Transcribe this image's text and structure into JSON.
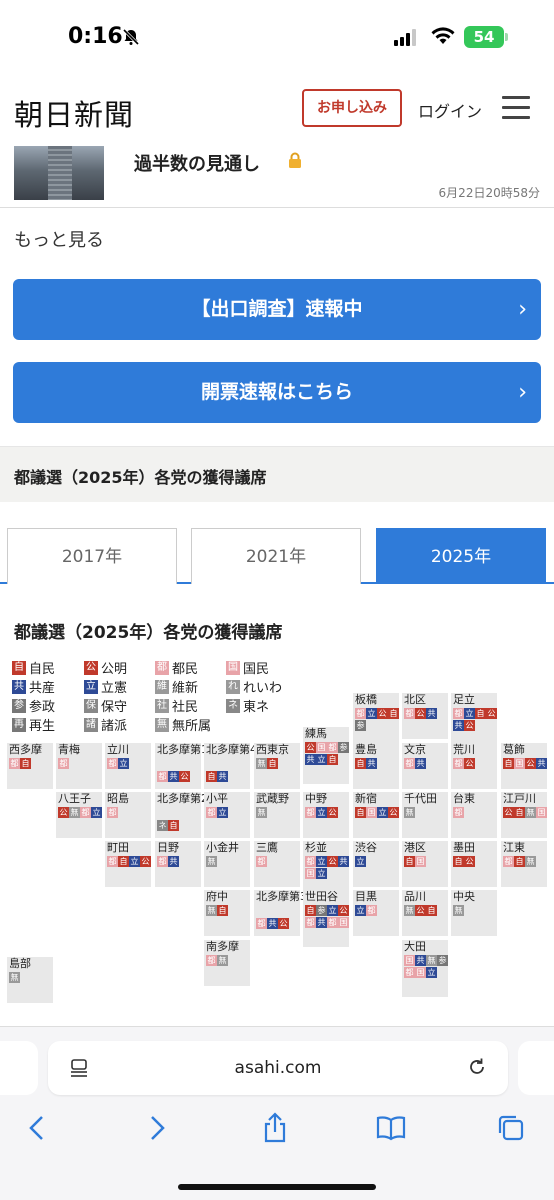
{
  "status": {
    "time": "0:16",
    "battery": "54"
  },
  "header": {
    "logo": "朝日新聞",
    "apply": "お申し込み",
    "login": "ログイン"
  },
  "article": {
    "title": "過半数の見通し",
    "date": "6月22日20時58分"
  },
  "more": "もっと見る",
  "buttons": {
    "exit_poll": "【出口調査】速報中",
    "counting": "開票速報はこちら"
  },
  "section_title": "都議選（2025年）各党の獲得議席",
  "tabs": [
    "2017年",
    "2021年",
    "2025年"
  ],
  "active_tab": "2025年",
  "map_title": "都議選（2025年）各党の獲得議席",
  "colors": {
    "jimin": "#c0392b",
    "komei": "#c0392b",
    "tomin": "#e8a3a8",
    "kokumin": "#e8a3a8",
    "kyosan": "#2e4a96",
    "rikken": "#2e4a96",
    "sansei": "#777",
    "ishin": "#999",
    "reiwa": "#999",
    "saisei": "#777",
    "hoshu": "#888",
    "shaminn": "#999",
    "shoha": "#888",
    "tone": "#888",
    "musho": "#999"
  },
  "legend": [
    {
      "abbr": "自",
      "label": "自民",
      "color": "#c0392b"
    },
    {
      "abbr": "公",
      "label": "公明",
      "color": "#c0392b"
    },
    {
      "abbr": "都",
      "label": "都民",
      "color": "#e8a3a8"
    },
    {
      "abbr": "国",
      "label": "国民",
      "color": "#e8a3a8"
    },
    {
      "abbr": "共",
      "label": "共産",
      "color": "#2e4a96"
    },
    {
      "abbr": "立",
      "label": "立憲",
      "color": "#2e4a96"
    },
    {
      "abbr": "維",
      "label": "維新",
      "color": "#999"
    },
    {
      "abbr": "れ",
      "label": "れいわ",
      "color": "#999"
    },
    {
      "abbr": "参",
      "label": "参政",
      "color": "#777"
    },
    {
      "abbr": "保",
      "label": "保守",
      "color": "#888"
    },
    {
      "abbr": "社",
      "label": "社民",
      "color": "#999"
    },
    {
      "abbr": "ネ",
      "label": "東ネ",
      "color": "#888"
    },
    {
      "abbr": "再",
      "label": "再生",
      "color": "#777"
    },
    {
      "abbr": "諸",
      "label": "諸派",
      "color": "#888"
    },
    {
      "abbr": "無",
      "label": "無所属",
      "color": "#999"
    }
  ],
  "districts": [
    {
      "name": "板橋",
      "seats": [
        "都",
        "立",
        "公",
        "自",
        "参"
      ]
    },
    {
      "name": "北区",
      "seats": [
        "都",
        "公",
        "共"
      ]
    },
    {
      "name": "足立",
      "seats": [
        "都",
        "立",
        "自",
        "公",
        "共",
        "公"
      ]
    },
    {
      "name": "練馬",
      "seats": [
        "公",
        "国",
        "都",
        "参",
        "共",
        "立",
        "自"
      ]
    },
    {
      "name": "西多摩",
      "seats": [
        "都",
        "自"
      ]
    },
    {
      "name": "青梅",
      "seats": [
        "都"
      ]
    },
    {
      "name": "立川",
      "seats": [
        "都",
        "立"
      ]
    },
    {
      "name": "北多摩第1",
      "seats": [
        "都",
        "共",
        "公"
      ]
    },
    {
      "name": "北多摩第4",
      "seats": [
        "自",
        "共"
      ]
    },
    {
      "name": "西東京",
      "seats": [
        "無",
        "自"
      ]
    },
    {
      "name": "豊島",
      "seats": [
        "自",
        "共"
      ]
    },
    {
      "name": "文京",
      "seats": [
        "都",
        "共"
      ]
    },
    {
      "name": "荒川",
      "seats": [
        "都",
        "公"
      ]
    },
    {
      "name": "葛飾",
      "seats": [
        "自",
        "国",
        "公",
        "共"
      ]
    },
    {
      "name": "八王子",
      "seats": [
        "公",
        "無",
        "都",
        "立"
      ]
    },
    {
      "name": "昭島",
      "seats": [
        "都"
      ]
    },
    {
      "name": "北多摩第2",
      "seats": [
        "ネ",
        "自"
      ]
    },
    {
      "name": "小平",
      "seats": [
        "都",
        "立"
      ]
    },
    {
      "name": "武蔵野",
      "seats": [
        "無"
      ]
    },
    {
      "name": "中野",
      "seats": [
        "都",
        "立",
        "公"
      ]
    },
    {
      "name": "新宿",
      "seats": [
        "自",
        "国",
        "立",
        "公"
      ]
    },
    {
      "name": "千代田",
      "seats": [
        "無"
      ]
    },
    {
      "name": "台東",
      "seats": [
        "都"
      ]
    },
    {
      "name": "江戸川",
      "seats": [
        "公",
        "自",
        "無",
        "国"
      ]
    },
    {
      "name": "町田",
      "seats": [
        "都",
        "自",
        "立",
        "公"
      ]
    },
    {
      "name": "日野",
      "seats": [
        "都",
        "共"
      ]
    },
    {
      "name": "小金井",
      "seats": [
        "無"
      ]
    },
    {
      "name": "三鷹",
      "seats": [
        "都"
      ]
    },
    {
      "name": "杉並",
      "seats": [
        "都",
        "立",
        "公",
        "共",
        "国",
        "立"
      ]
    },
    {
      "name": "渋谷",
      "seats": [
        "立"
      ]
    },
    {
      "name": "港区",
      "seats": [
        "自",
        "国"
      ]
    },
    {
      "name": "墨田",
      "seats": [
        "自",
        "公"
      ]
    },
    {
      "name": "江東",
      "seats": [
        "都",
        "自",
        "無"
      ]
    },
    {
      "name": "府中",
      "seats": [
        "無",
        "自"
      ]
    },
    {
      "name": "北多摩第3",
      "seats": [
        "都",
        "共",
        "公"
      ]
    },
    {
      "name": "世田谷",
      "seats": [
        "自",
        "参",
        "立",
        "公",
        "都",
        "共",
        "都",
        "国"
      ]
    },
    {
      "name": "目黒",
      "seats": [
        "立",
        "都"
      ]
    },
    {
      "name": "品川",
      "seats": [
        "無",
        "公",
        "自"
      ]
    },
    {
      "name": "中央",
      "seats": [
        "無"
      ]
    },
    {
      "name": "南多摩",
      "seats": [
        "都",
        "無"
      ]
    },
    {
      "name": "大田",
      "seats": [
        "国",
        "共",
        "無",
        "参",
        "都",
        "国",
        "立"
      ]
    },
    {
      "name": "島部",
      "seats": [
        "無"
      ]
    }
  ],
  "browser": {
    "url": "asahi.com"
  }
}
